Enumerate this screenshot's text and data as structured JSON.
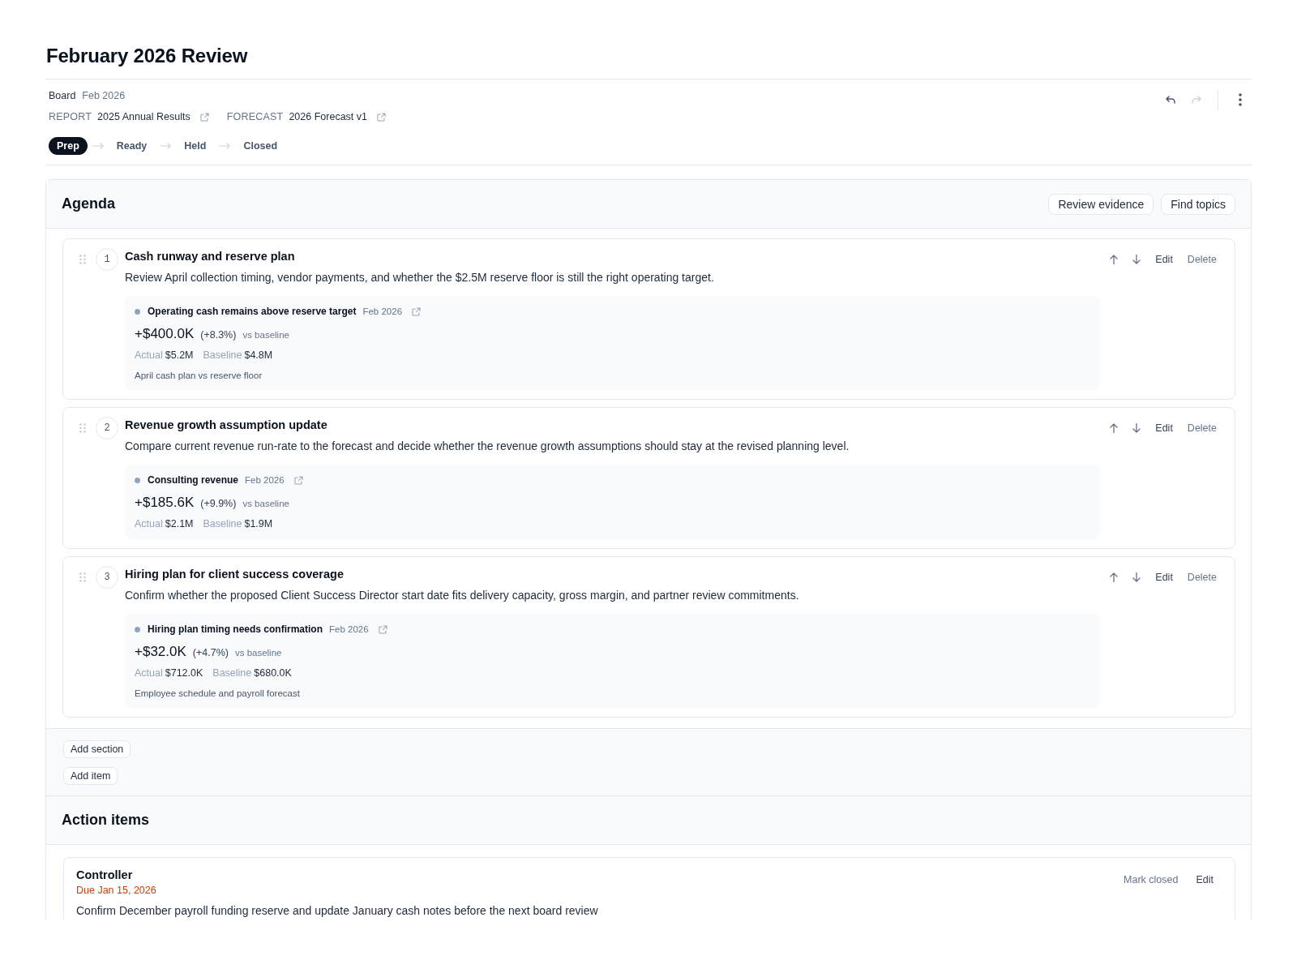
{
  "page": {
    "title": "February 2026 Review"
  },
  "meta": {
    "type_label": "Board",
    "period": "Feb 2026",
    "links": [
      {
        "label": "REPORT",
        "value": "2025 Annual Results"
      },
      {
        "label": "FORECAST",
        "value": "2026 Forecast v1"
      }
    ]
  },
  "history": [
    {
      "kind": "undo",
      "disabled": false
    },
    {
      "kind": "redo",
      "disabled": true
    }
  ],
  "stages": [
    {
      "label": "Prep",
      "selected": true
    },
    {
      "label": "Ready",
      "selected": false
    },
    {
      "label": "Held",
      "selected": false
    },
    {
      "label": "Closed",
      "selected": false
    }
  ],
  "agenda": {
    "title": "Agenda",
    "buttons": [
      "Review evidence",
      "Find topics"
    ],
    "items": [
      {
        "number": "1",
        "title": "Cash runway and reserve plan",
        "description": "Review April collection timing, vendor payments, and whether the $2.5M reserve floor is still the right operating target.",
        "evidence": {
          "title": "Operating cash remains above reserve target",
          "date": "Feb 2026",
          "delta": "+$400.0K",
          "change": "(+8.3%)",
          "comparison": "vs baseline",
          "actual_label": "Actual",
          "actual": "$5.2M",
          "baseline_label": "Baseline",
          "baseline": "$4.8M",
          "note": "April cash plan vs reserve floor"
        },
        "actions": [
          {
            "kind": "edit",
            "label": "Edit"
          },
          {
            "kind": "delete",
            "label": "Delete"
          }
        ]
      },
      {
        "number": "2",
        "title": "Revenue growth assumption update",
        "description": "Compare current revenue run-rate to the forecast and decide whether the revenue growth assumptions should stay at the revised planning level.",
        "evidence": {
          "title": "Consulting revenue",
          "date": "Feb 2026",
          "delta": "+$185.6K",
          "change": "(+9.9%)",
          "comparison": "vs baseline",
          "actual_label": "Actual",
          "actual": "$2.1M",
          "baseline_label": "Baseline",
          "baseline": "$1.9M"
        },
        "actions": [
          {
            "kind": "edit",
            "label": "Edit"
          },
          {
            "kind": "delete",
            "label": "Delete"
          }
        ]
      },
      {
        "number": "3",
        "title": "Hiring plan for client success coverage",
        "description": "Confirm whether the proposed Client Success Director start date fits delivery capacity, gross margin, and partner review commitments.",
        "evidence": {
          "title": "Hiring plan timing needs confirmation",
          "date": "Feb 2026",
          "delta": "+$32.0K",
          "change": "(+4.7%)",
          "comparison": "vs baseline",
          "actual_label": "Actual",
          "actual": "$712.0K",
          "baseline_label": "Baseline",
          "baseline": "$680.0K",
          "note": "Employee schedule and payroll forecast"
        },
        "actions": [
          {
            "kind": "edit",
            "label": "Edit"
          },
          {
            "kind": "delete",
            "label": "Delete"
          }
        ]
      }
    ],
    "footer_buttons": [
      "Add section",
      "Add item"
    ]
  },
  "action_items": {
    "title": "Action items",
    "items": [
      {
        "owner": "Controller",
        "due": "Due Jan 15, 2026",
        "description": "Confirm December payroll funding reserve and update January cash notes before the next board review",
        "actions": [
          {
            "kind": "close",
            "label": "Mark closed"
          },
          {
            "kind": "edit",
            "label": "Edit"
          }
        ]
      }
    ]
  }
}
